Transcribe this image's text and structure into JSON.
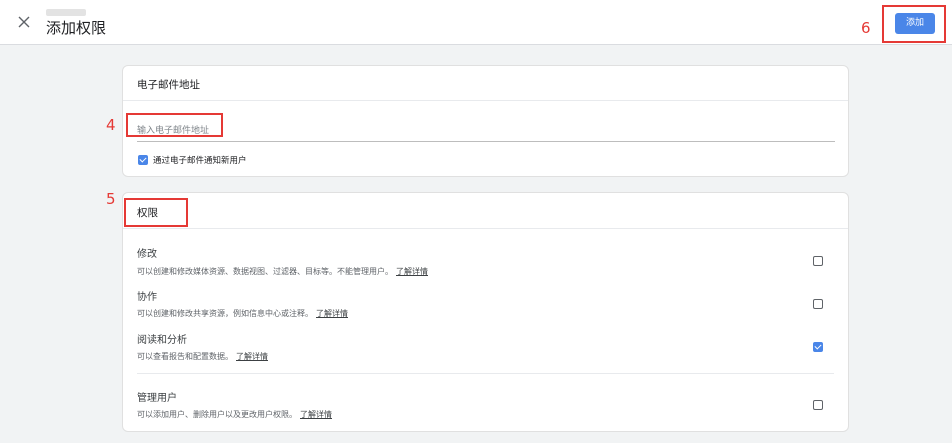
{
  "header": {
    "title": "添加权限",
    "add_label": "添加"
  },
  "annotations": {
    "email_input": "4",
    "permissions_title": "5",
    "add_button": "6"
  },
  "email_section": {
    "title": "电子邮件地址",
    "placeholder": "输入电子邮件地址",
    "value": "",
    "notify_label": "通过电子邮件通知新用户",
    "notify_checked": true
  },
  "permissions_section": {
    "title": "权限",
    "learn_more": "了解详情",
    "items": [
      {
        "name": "修改",
        "desc": "可以创建和修改媒体资源、数据视图、过滤器、目标等。不能管理用户。",
        "checked": false
      },
      {
        "name": "协作",
        "desc": "可以创建和修改共享资源，例如信息中心或注释。",
        "checked": false
      },
      {
        "name": "阅读和分析",
        "desc": "可以查看报告和配置数据。",
        "checked": true
      },
      {
        "name": "管理用户",
        "desc": "可以添加用户、删除用户以及更改用户权限。",
        "checked": false
      }
    ]
  },
  "colors": {
    "accent": "#4a86e8",
    "annotation": "#e53935",
    "background": "#f1f3f4"
  }
}
